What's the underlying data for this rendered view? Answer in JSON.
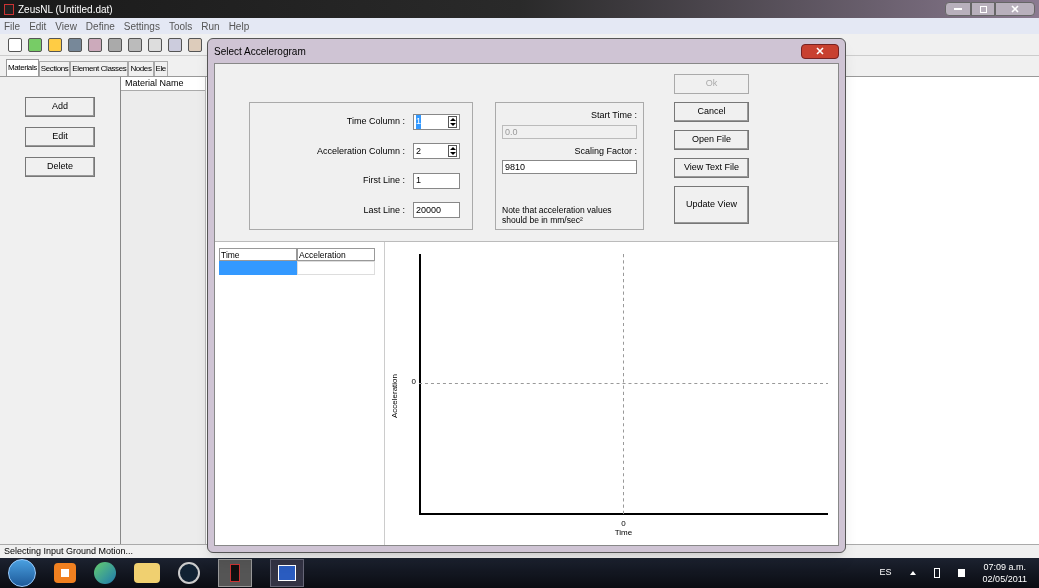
{
  "window": {
    "title": "ZeusNL  (Untitled.dat)"
  },
  "menu": [
    "File",
    "Edit",
    "View",
    "Define",
    "Settings",
    "Tools",
    "Run",
    "Help"
  ],
  "tabs": [
    {
      "label": "Materials",
      "selected": true
    },
    {
      "label": "Sections",
      "selected": false
    },
    {
      "label": "Element Classes",
      "selected": false
    },
    {
      "label": "Nodes",
      "selected": false
    },
    {
      "label": "Ele",
      "selected": false
    }
  ],
  "side_buttons": [
    "Add",
    "Edit",
    "Delete"
  ],
  "list": {
    "column": "Material Name"
  },
  "dialog": {
    "title": "Select Accelerogram",
    "left_fields": [
      {
        "label": "Time Column :",
        "value": "1",
        "kind": "spin",
        "selected": true
      },
      {
        "label": "Acceleration Column :",
        "value": "2",
        "kind": "spin",
        "selected": false
      },
      {
        "label": "First Line :",
        "value": "1",
        "kind": "text",
        "selected": false
      },
      {
        "label": "Last Line :",
        "value": "20000",
        "kind": "text",
        "selected": false
      }
    ],
    "right_fields": [
      {
        "label": "Start Time :",
        "value": "0.0",
        "disabled": true
      },
      {
        "label": "Scaling Factor :",
        "value": "9810",
        "disabled": false
      }
    ],
    "note": "Note that acceleration values should be in mm/sec²",
    "buttons": [
      {
        "label": "Ok",
        "disabled": true
      },
      {
        "label": "Cancel",
        "disabled": false
      },
      {
        "label": "Open File",
        "disabled": false
      },
      {
        "label": "View Text File",
        "disabled": false
      },
      {
        "label": "Update View",
        "disabled": false
      }
    ],
    "table": {
      "columns": [
        "Time",
        "Acceleration"
      ],
      "rows": [
        {
          "selected": true
        }
      ]
    },
    "chart": {
      "xlabel": "Time",
      "ylabel": "Acceleration",
      "xtick": "0",
      "ytick": "0"
    }
  },
  "status_bar": "Selecting Input Ground Motion...",
  "taskbar": {
    "language": "ES",
    "time": "07:09 a.m.",
    "date": "02/05/2011"
  }
}
